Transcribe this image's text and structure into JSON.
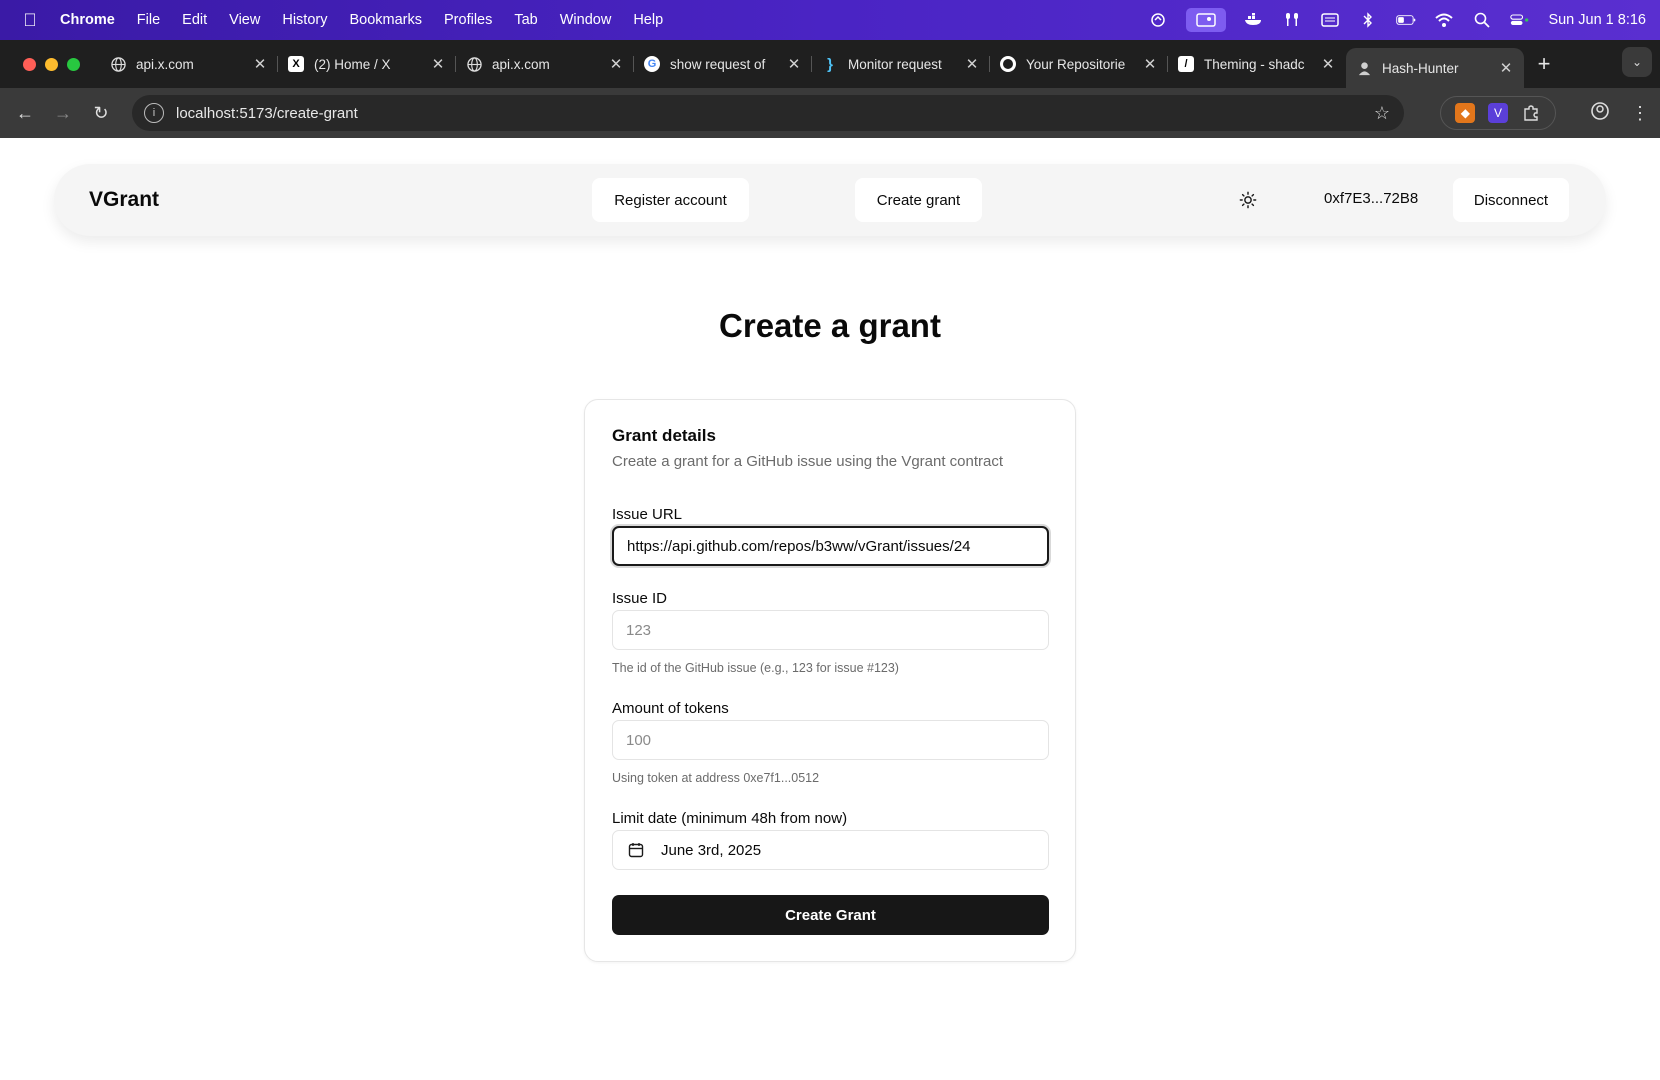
{
  "os_menubar": {
    "app": "Chrome",
    "menus": [
      "File",
      "Edit",
      "View",
      "History",
      "Bookmarks",
      "Profiles",
      "Tab",
      "Window",
      "Help"
    ],
    "clock": "Sun Jun 1  8:16"
  },
  "browser": {
    "tabs": [
      {
        "label": "api.x.com",
        "icon": "globe-icon"
      },
      {
        "label": "(2) Home / X",
        "icon": "x-logo-icon"
      },
      {
        "label": "api.x.com",
        "icon": "globe-icon"
      },
      {
        "label": "show request of",
        "icon": "google-icon"
      },
      {
        "label": "Monitor request",
        "icon": "brackets-icon"
      },
      {
        "label": "Your Repositorie",
        "icon": "github-icon"
      },
      {
        "label": "Theming - shadc",
        "icon": "slash-icon"
      },
      {
        "label": "Hash-Hunter",
        "icon": "hunter-icon",
        "active": true
      }
    ],
    "url": "localhost:5173/create-grant"
  },
  "header": {
    "brand": "VGrant",
    "register_label": "Register account",
    "create_label": "Create grant",
    "wallet": "0xf7E3...72B8",
    "disconnect_label": "Disconnect"
  },
  "page": {
    "title": "Create a grant"
  },
  "form": {
    "card_title": "Grant details",
    "card_description": "Create a grant for a GitHub issue using the Vgrant contract",
    "issue_url_label": "Issue URL",
    "issue_url_value": "https://api.github.com/repos/b3ww/vGrant/issues/24",
    "issue_id_label": "Issue ID",
    "issue_id_placeholder": "123",
    "issue_id_hint": "The id of the GitHub issue (e.g., 123 for issue #123)",
    "amount_label": "Amount of tokens",
    "amount_placeholder": "100",
    "amount_hint": "Using token at address 0xe7f1...0512",
    "limit_label": "Limit date (minimum 48h from now)",
    "limit_value": "June 3rd, 2025",
    "submit_label": "Create Grant"
  },
  "colors": {
    "menubar": "#4a24c4",
    "tabstrip": "#1f1f1f",
    "toolbar": "#3a3a3a",
    "primary_button": "#171717",
    "header_bg": "#f5f5f5"
  }
}
